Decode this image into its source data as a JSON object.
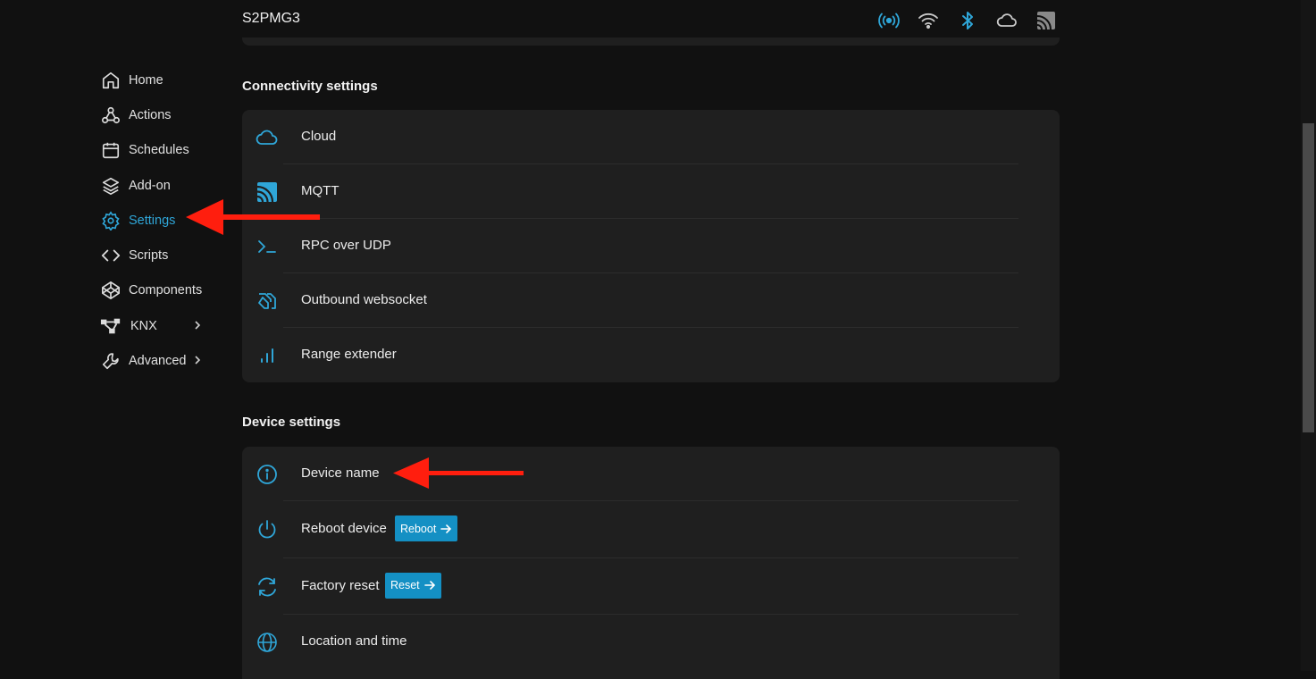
{
  "header": {
    "device_name": "S2PMG3",
    "status_icons": [
      "signal-broadcast-icon",
      "wifi-icon",
      "bluetooth-icon",
      "cloud-icon",
      "mqtt-icon"
    ]
  },
  "sidebar": {
    "items": [
      {
        "label": "Home",
        "icon": "home-icon"
      },
      {
        "label": "Actions",
        "icon": "webhook-icon"
      },
      {
        "label": "Schedules",
        "icon": "calendar-icon"
      },
      {
        "label": "Add-on",
        "icon": "layers-icon"
      },
      {
        "label": "Settings",
        "icon": "gear-icon",
        "active": true
      },
      {
        "label": "Scripts",
        "icon": "code-icon"
      },
      {
        "label": "Components",
        "icon": "codepen-icon"
      },
      {
        "label": "KNX",
        "icon": "knx-network-icon",
        "expandable": true
      },
      {
        "label": "Advanced",
        "icon": "wrench-icon",
        "expandable": true
      }
    ]
  },
  "connectivity": {
    "title": "Connectivity settings",
    "items": [
      {
        "label": "Cloud",
        "icon": "cloud-icon"
      },
      {
        "label": "MQTT",
        "icon": "mqtt-icon"
      },
      {
        "label": "RPC over UDP",
        "icon": "terminal-icon"
      },
      {
        "label": "Outbound websocket",
        "icon": "websocket-icon"
      },
      {
        "label": "Range extender",
        "icon": "signal-bars-icon"
      }
    ]
  },
  "device": {
    "title": "Device settings",
    "items": [
      {
        "label": "Device name",
        "icon": "info-icon"
      },
      {
        "label": "Reboot device",
        "icon": "power-icon",
        "button": "Reboot"
      },
      {
        "label": "Factory reset",
        "icon": "reset-icon",
        "button": "Reset"
      },
      {
        "label": "Location and time",
        "icon": "globe-icon"
      }
    ]
  },
  "colors": {
    "background": "#111111",
    "card": "#1f1f1f",
    "accent": "#2fa6d8",
    "button": "#1490c4",
    "annotation_arrow": "#ff1e0e"
  }
}
